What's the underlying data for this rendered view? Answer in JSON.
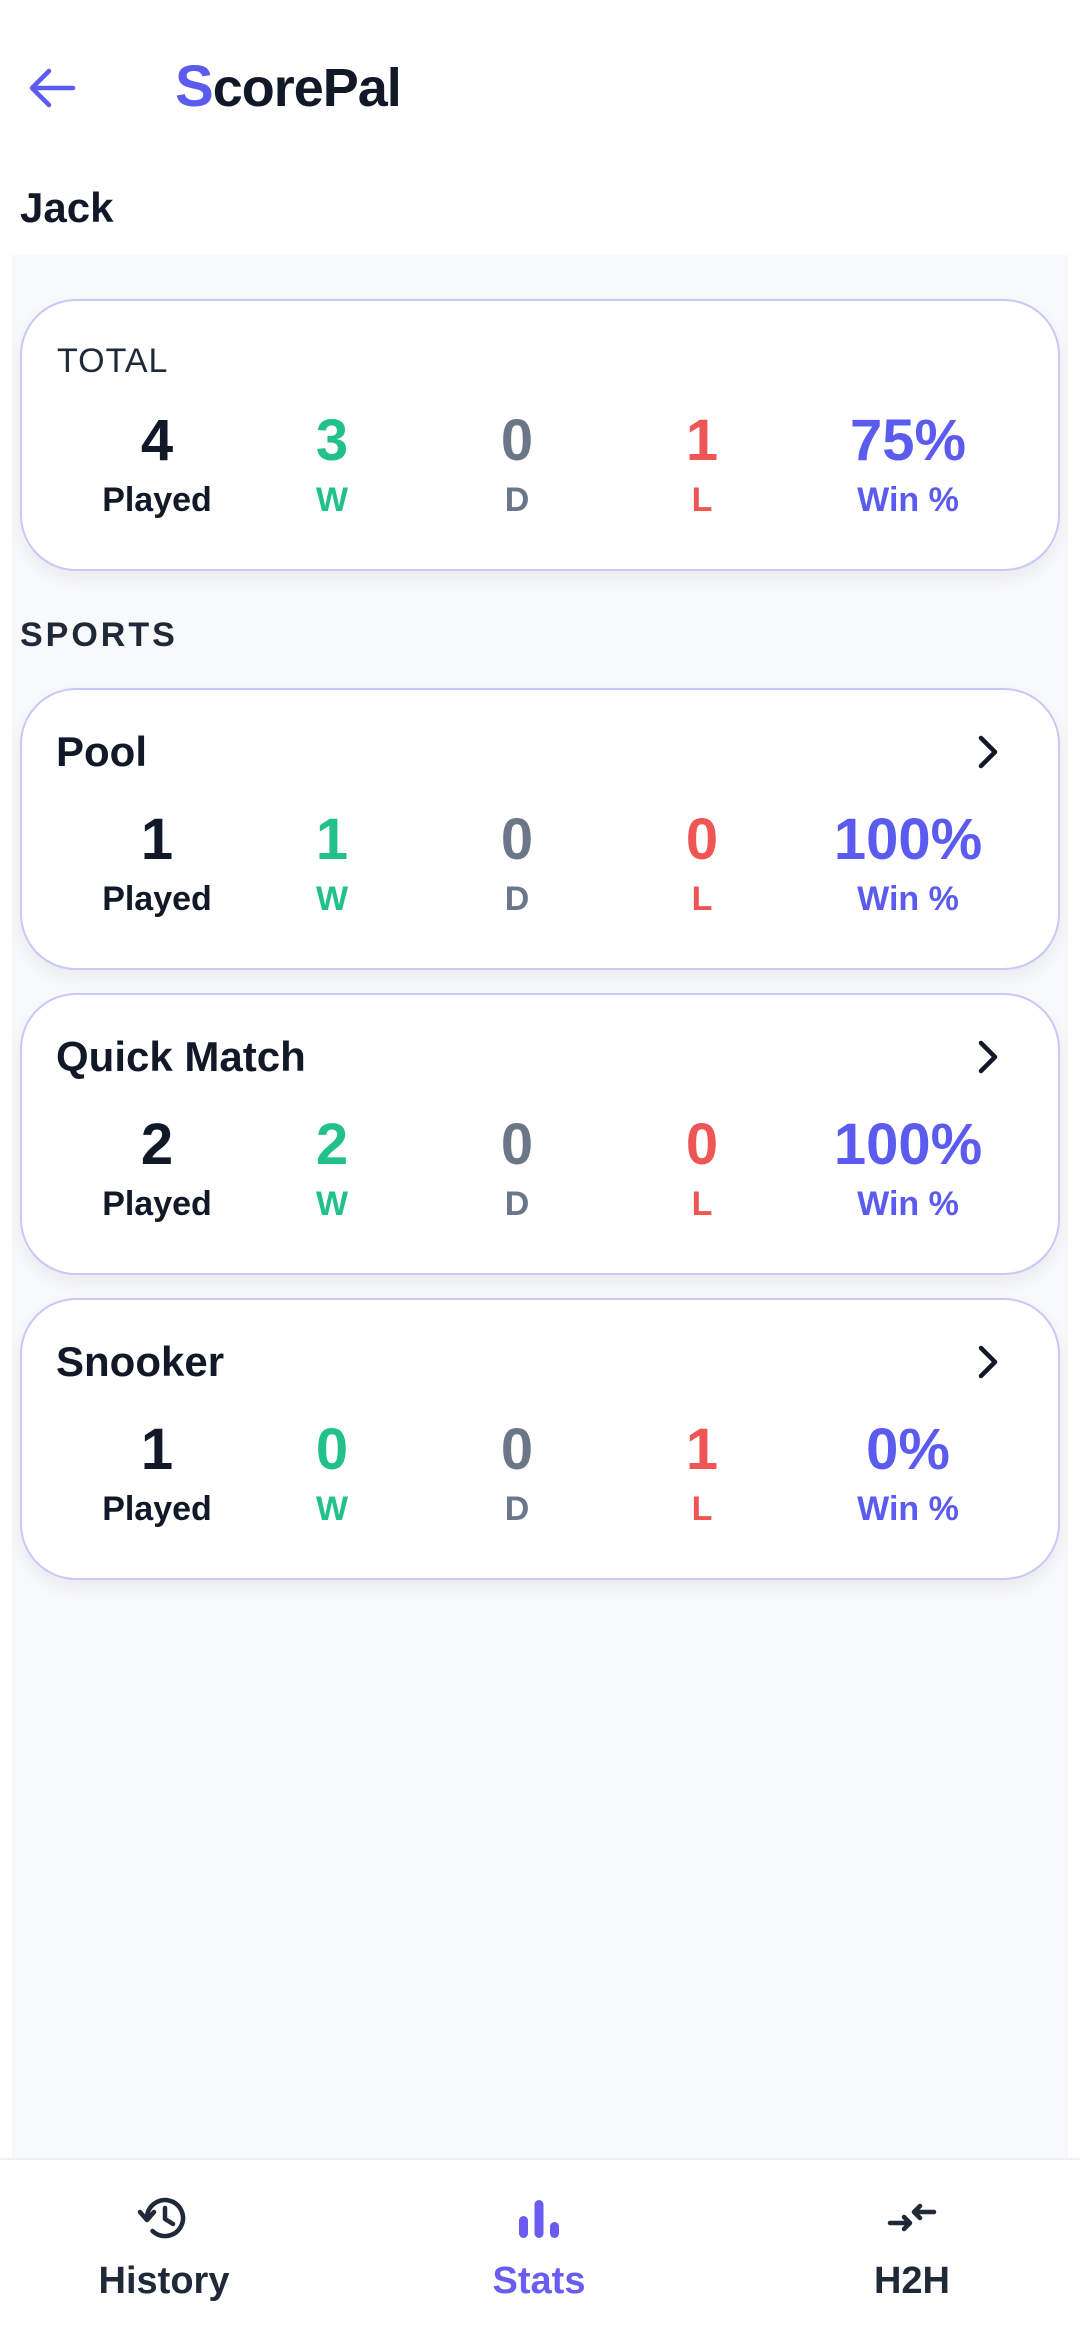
{
  "app": {
    "logo_first_letter": "S",
    "logo_rest": "corePal"
  },
  "player": {
    "name": "Jack"
  },
  "total": {
    "caption": "TOTAL",
    "played": "4",
    "wins": "3",
    "draws": "0",
    "losses": "1",
    "win_pct": "75%"
  },
  "labels": {
    "played": "Played",
    "w": "W",
    "d": "D",
    "l": "L",
    "win_pct": "Win %"
  },
  "sports_heading": "SPORTS",
  "sports": [
    {
      "name": "Pool",
      "played": "1",
      "wins": "1",
      "draws": "0",
      "losses": "0",
      "win_pct": "100%"
    },
    {
      "name": "Quick Match",
      "played": "2",
      "wins": "2",
      "draws": "0",
      "losses": "0",
      "win_pct": "100%"
    },
    {
      "name": "Snooker",
      "played": "1",
      "wins": "0",
      "draws": "0",
      "losses": "1",
      "win_pct": "0%"
    }
  ],
  "nav": {
    "history": {
      "label": "History",
      "icon": "history-icon"
    },
    "stats": {
      "label": "Stats",
      "icon": "bar-chart-icon"
    },
    "h2h": {
      "label": "H2H",
      "icon": "compare-arrows-icon"
    }
  },
  "colors": {
    "accent": "#5b5bf0",
    "win": "#22c08a",
    "draw": "#6b7689",
    "loss": "#ef5555",
    "card_border": "#c9c8f7"
  }
}
